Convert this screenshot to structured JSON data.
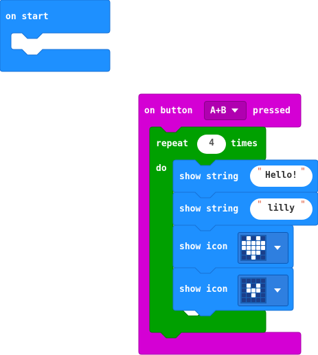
{
  "on_start": {
    "label": "on start"
  },
  "button_event": {
    "prefix": "on button",
    "button_value": "A+B",
    "suffix": "pressed"
  },
  "repeat": {
    "label": "repeat",
    "count": "4",
    "times_label": "times",
    "do_label": "do"
  },
  "statements": [
    {
      "type": "show string",
      "label": "show string",
      "value": "Hello!"
    },
    {
      "type": "show string",
      "label": "show string",
      "value": "lilly"
    },
    {
      "type": "show icon",
      "label": "show icon",
      "icon": "heart"
    },
    {
      "type": "show icon",
      "label": "show icon",
      "icon": "small-heart"
    }
  ],
  "icons": {
    "heart": [
      [
        0,
        1,
        0,
        1,
        0
      ],
      [
        1,
        1,
        1,
        1,
        1
      ],
      [
        1,
        1,
        1,
        1,
        1
      ],
      [
        0,
        1,
        1,
        1,
        0
      ],
      [
        0,
        0,
        1,
        0,
        0
      ]
    ],
    "small_heart": [
      [
        0,
        0,
        0,
        0,
        0
      ],
      [
        0,
        1,
        0,
        1,
        0
      ],
      [
        0,
        1,
        1,
        1,
        0
      ],
      [
        0,
        0,
        1,
        0,
        0
      ],
      [
        0,
        0,
        0,
        0,
        0
      ]
    ]
  },
  "colors": {
    "basic_blue": "#1e90ff",
    "input_magenta": "#d400d4",
    "loop_green": "#00a000"
  }
}
